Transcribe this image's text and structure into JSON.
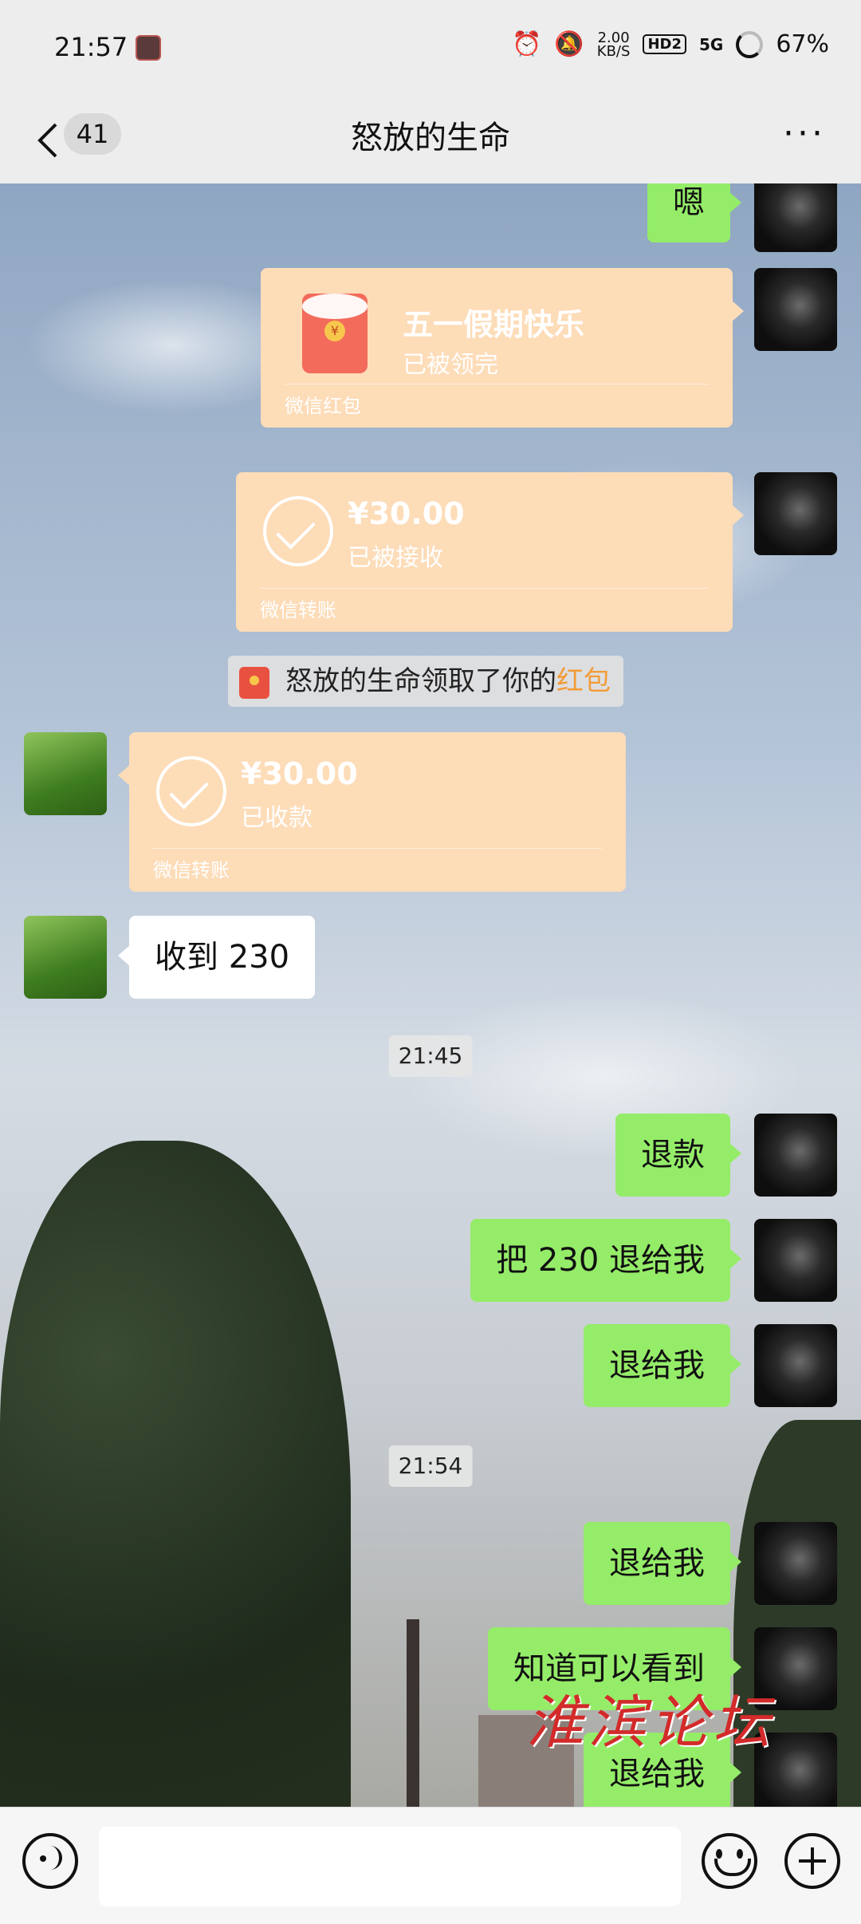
{
  "status_bar": {
    "time": "21:57",
    "net_rate_value": "2.00",
    "net_rate_unit": "KB/S",
    "hd": "HD2",
    "signal": "5G",
    "battery": "67%"
  },
  "nav": {
    "unread_count": "41",
    "title": "怒放的生命"
  },
  "messages": {
    "m1": "嗯",
    "redpacket": {
      "greeting": "五一假期快乐",
      "status": "已被领完",
      "footer": "微信红包",
      "coin": "¥"
    },
    "transfer_sent": {
      "amount": "¥30.00",
      "status": "已被接收",
      "footer": "微信转账"
    },
    "notice": {
      "text": "怒放的生命领取了你的",
      "highlight": "红包"
    },
    "transfer_received": {
      "amount": "¥30.00",
      "status": "已收款",
      "footer": "微信转账"
    },
    "received_text": "收到 230",
    "time1": "21:45",
    "m_refund": "退款",
    "m_return230": "把 230 退给我",
    "m_return1": "退给我",
    "time2": "21:54",
    "m_return2": "退给我",
    "m_know": "知道可以看到",
    "m_return3": "退给我"
  },
  "watermark": "淮滨论坛",
  "input": {
    "placeholder": ""
  }
}
